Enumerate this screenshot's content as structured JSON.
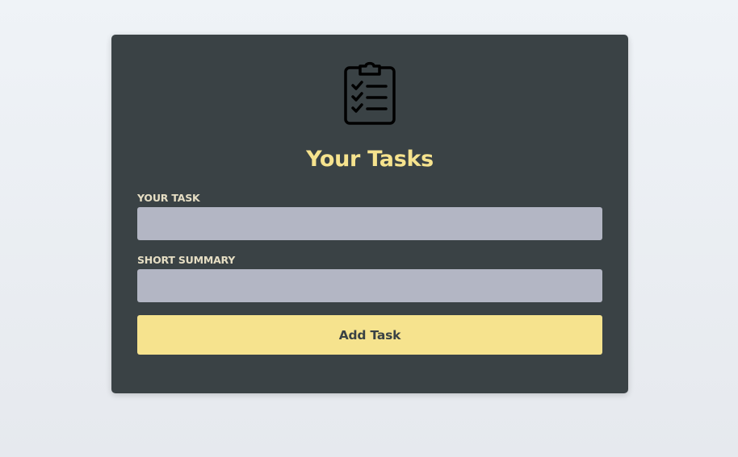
{
  "header": {
    "icon": "clipboard-checklist-icon",
    "title": "Your Tasks"
  },
  "form": {
    "task_label": "YOUR TASK",
    "task_value": "",
    "summary_label": "SHORT SUMMARY",
    "summary_value": "",
    "submit_label": "Add Task"
  },
  "colors": {
    "page_background": "#eff3f7",
    "card_background": "#3a4245",
    "accent": "#f6e38e",
    "input_background": "#b3b6c4",
    "label_text": "#e6dec4"
  }
}
